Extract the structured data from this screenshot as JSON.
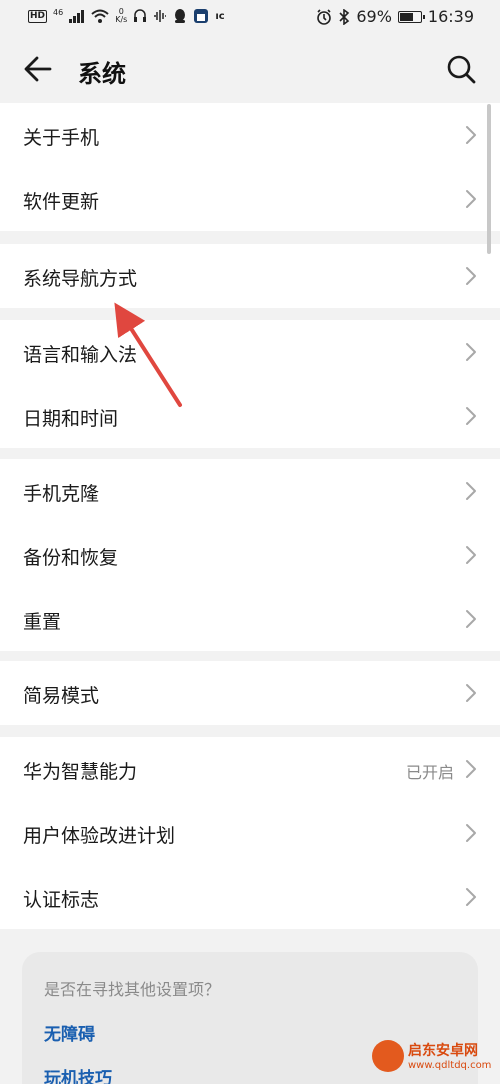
{
  "status_bar": {
    "hd": "HD",
    "net_gen": "46",
    "speed_value": "0",
    "speed_unit": "K/s",
    "app_badge": "ıc",
    "battery_percent": "69%",
    "battery_level": 0.69,
    "time": "16:39"
  },
  "header": {
    "title": "系统"
  },
  "groups": [
    {
      "items": [
        {
          "label": "关于手机"
        },
        {
          "label": "软件更新"
        }
      ]
    },
    {
      "items": [
        {
          "label": "系统导航方式"
        }
      ]
    },
    {
      "items": [
        {
          "label": "语言和输入法"
        },
        {
          "label": "日期和时间"
        }
      ]
    },
    {
      "items": [
        {
          "label": "手机克隆"
        },
        {
          "label": "备份和恢复"
        },
        {
          "label": "重置"
        }
      ]
    },
    {
      "items": [
        {
          "label": "简易模式"
        }
      ]
    },
    {
      "items": [
        {
          "label": "华为智慧能力",
          "value": "已开启"
        },
        {
          "label": "用户体验改进计划"
        },
        {
          "label": "认证标志"
        }
      ]
    }
  ],
  "suggestions": {
    "question": "是否在寻找其他设置项？",
    "links": [
      "无障碍",
      "玩机技巧"
    ]
  },
  "watermark": {
    "name": "启东安卓网",
    "url": "www.qdltdq.com"
  },
  "colors": {
    "background": "#f2f2f2",
    "link": "#1a5fb0",
    "annotation_arrow": "#e0473f"
  }
}
